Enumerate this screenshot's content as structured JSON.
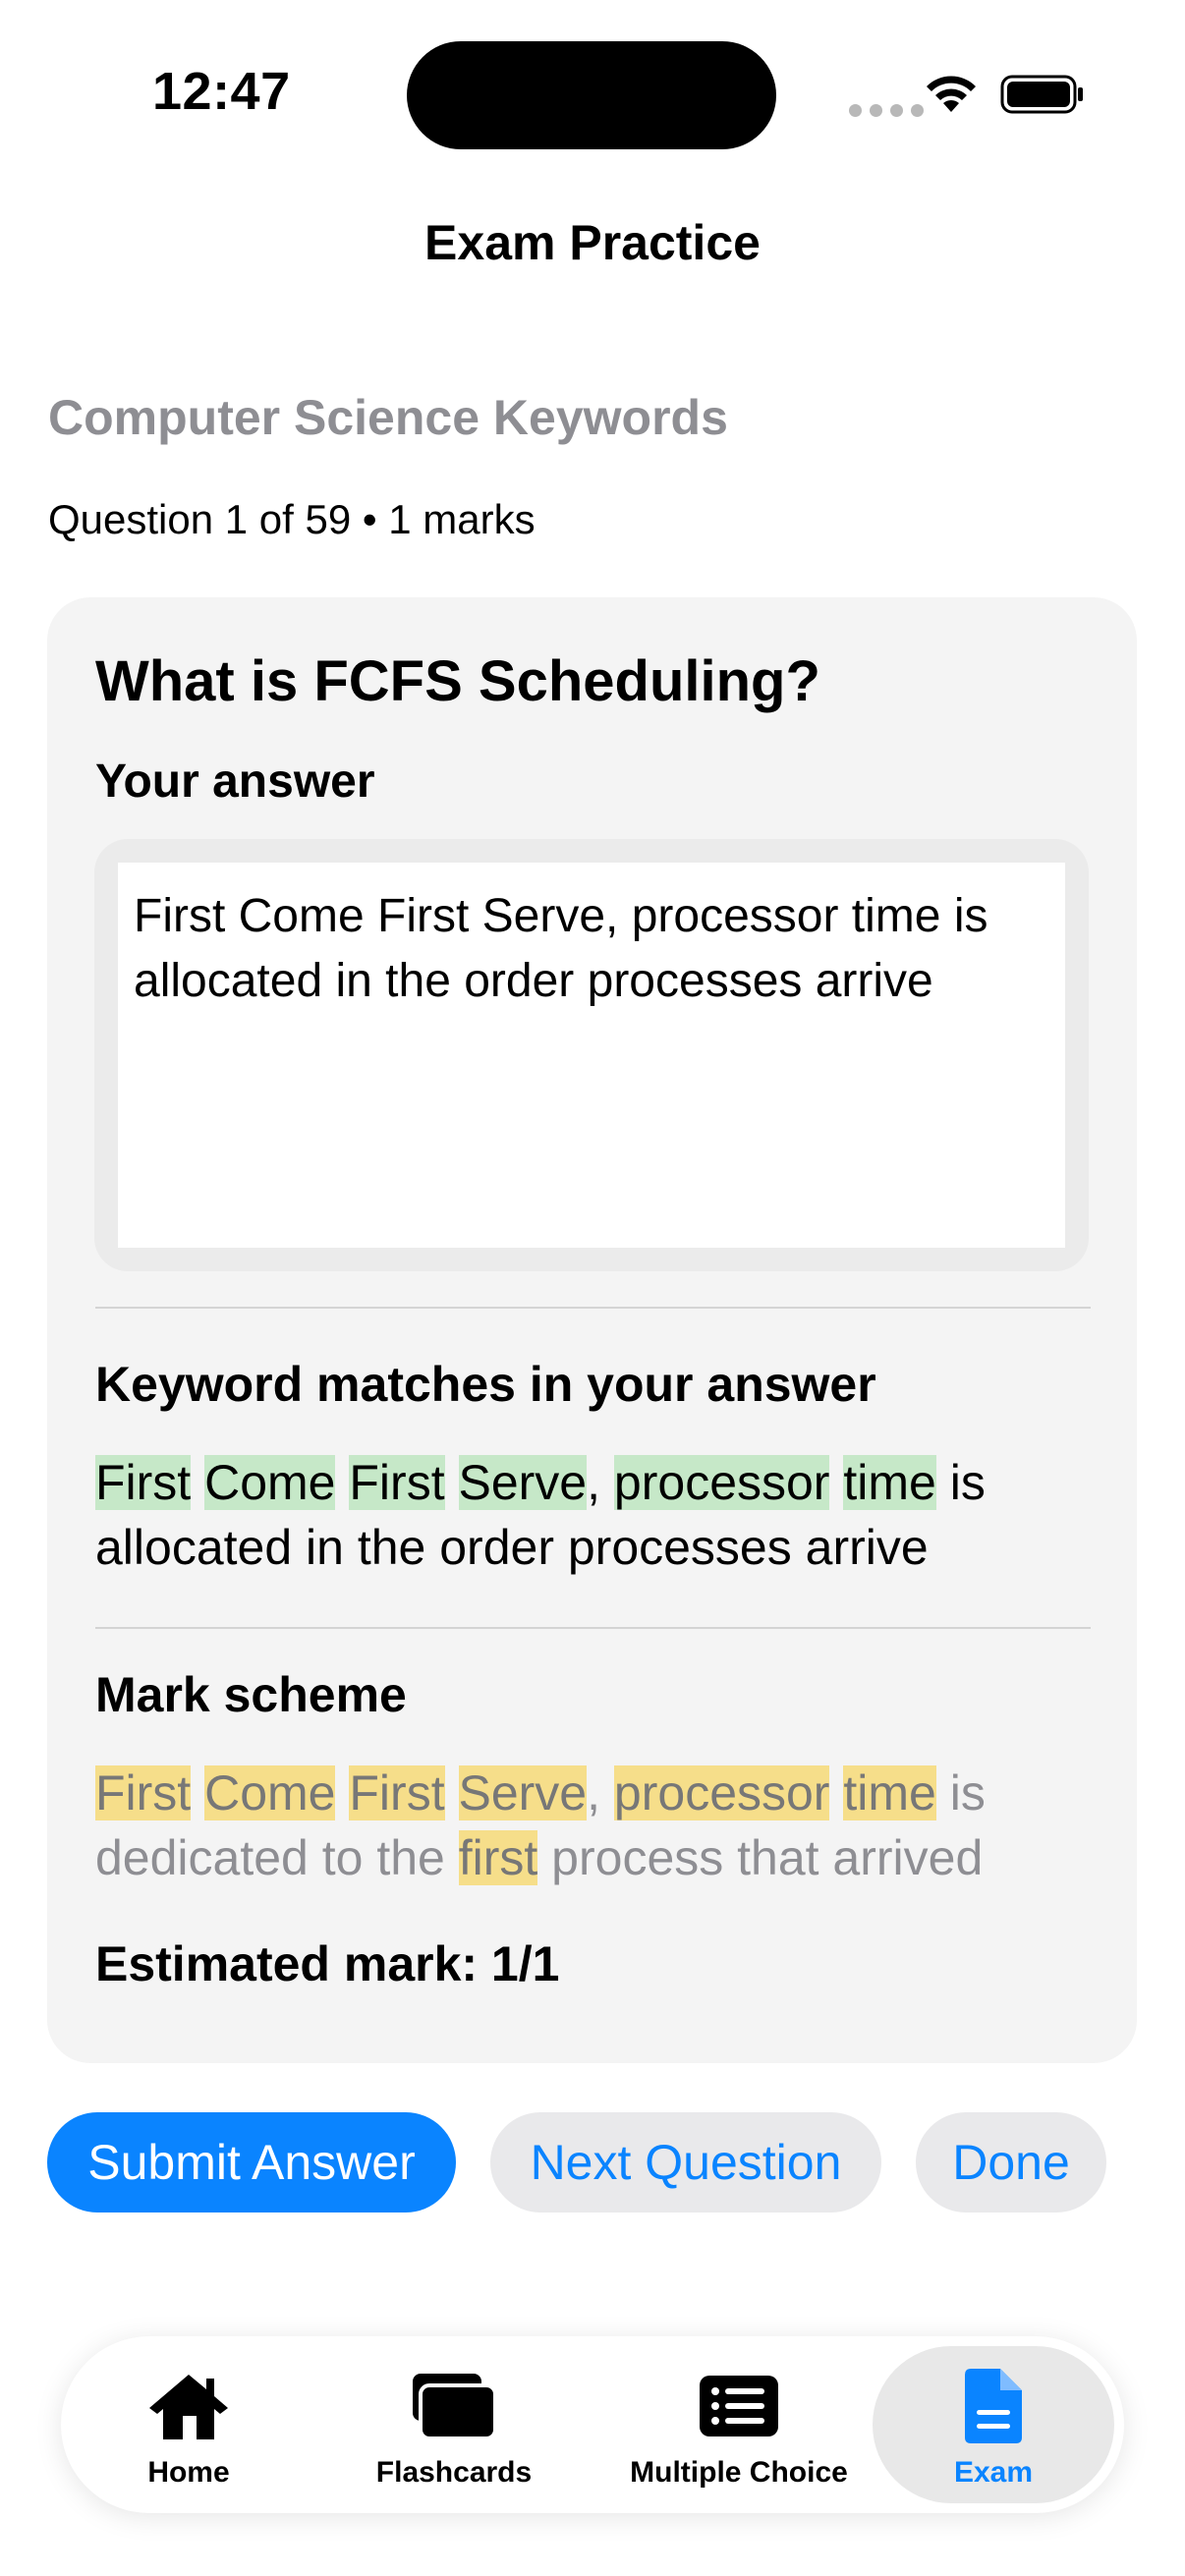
{
  "status_bar": {
    "time": "12:47"
  },
  "nav": {
    "title": "Exam Practice"
  },
  "deck": {
    "title": "Computer Science Keywords"
  },
  "question": {
    "meta": "Question 1 of 59 • 1 marks",
    "prompt": "What is FCFS Scheduling?",
    "answer_label": "Your answer",
    "answer_value": "First Come First Serve, processor time is allocated in the order processes arrive"
  },
  "keyword_matches": {
    "heading": "Keyword matches in your answer",
    "tokens": [
      {
        "t": "First",
        "hl": true
      },
      {
        "t": " "
      },
      {
        "t": "Come",
        "hl": true
      },
      {
        "t": " "
      },
      {
        "t": "First",
        "hl": true
      },
      {
        "t": " "
      },
      {
        "t": "Serve",
        "hl": true
      },
      {
        "t": ", "
      },
      {
        "t": "processor",
        "hl": true
      },
      {
        "t": " "
      },
      {
        "t": "time",
        "hl": true
      },
      {
        "t": " is allocated in the order processes arrive"
      }
    ]
  },
  "mark_scheme": {
    "heading": "Mark scheme",
    "tokens": [
      {
        "t": "First",
        "hl": true
      },
      {
        "t": " "
      },
      {
        "t": "Come",
        "hl": true
      },
      {
        "t": " "
      },
      {
        "t": "First",
        "hl": true
      },
      {
        "t": " "
      },
      {
        "t": "Serve",
        "hl": true
      },
      {
        "t": ", "
      },
      {
        "t": "processor",
        "hl": true
      },
      {
        "t": " "
      },
      {
        "t": "time",
        "hl": true
      },
      {
        "t": " is dedicated to the "
      },
      {
        "t": "first",
        "hl": true
      },
      {
        "t": " process that arrived"
      }
    ],
    "estimate": "Estimated mark: 1/1"
  },
  "actions": {
    "submit": "Submit Answer",
    "next": "Next Question",
    "done": "Done"
  },
  "tabs": [
    {
      "label": "Home",
      "icon": "house-icon",
      "selected": false
    },
    {
      "label": "Flashcards",
      "icon": "cards-icon",
      "selected": false
    },
    {
      "label": "Multiple Choice",
      "icon": "list-icon",
      "selected": false
    },
    {
      "label": "Exam",
      "icon": "document-icon",
      "selected": true
    }
  ],
  "colors": {
    "accent": "#0a84ff",
    "keyword_match_highlight": "#c6e8c8",
    "mark_scheme_highlight": "#f6de8a",
    "secondary_text": "#8e8e93"
  }
}
